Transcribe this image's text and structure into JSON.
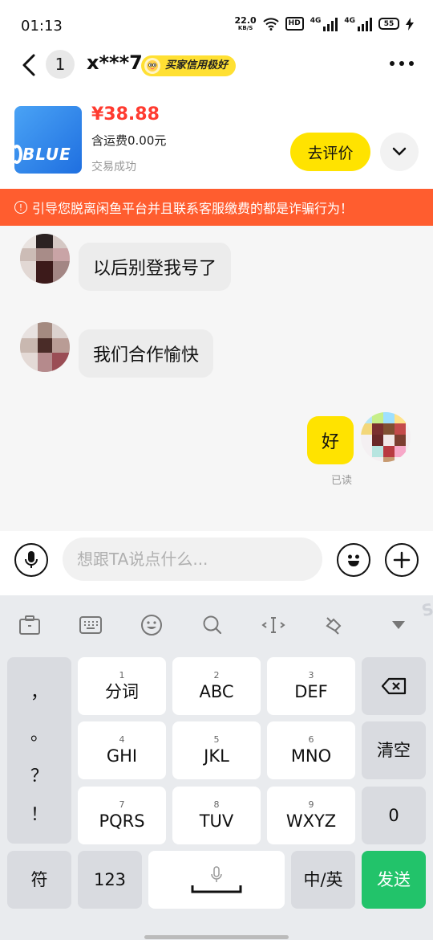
{
  "status": {
    "time": "01:13",
    "speed": "22.0",
    "speed_unit": "KB/S",
    "hd": "HD",
    "net1": "4G",
    "net2": "4G",
    "battery": "55"
  },
  "header": {
    "unread_count": "1",
    "username": "x***7",
    "credit_badge": "买家信用极好"
  },
  "product": {
    "price": "¥38.88",
    "shipping": "含运费0.00元",
    "status": "交易成功",
    "thumb_text": "BLUE",
    "review_button": "去评价"
  },
  "warning": {
    "text": "引导您脱离闲鱼平台并且联系客服缴费的都是诈骗行为！"
  },
  "messages": [
    {
      "side": "left",
      "text": "以后别登我号了"
    },
    {
      "side": "left",
      "text": "我们合作愉快"
    },
    {
      "side": "right",
      "text": "好",
      "receipt": "已读"
    }
  ],
  "input": {
    "placeholder": "想跟TA说点什么..."
  },
  "keyboard": {
    "punctuation": [
      "，",
      "。",
      "？",
      "！"
    ],
    "rows": [
      [
        {
          "num": "1",
          "label": "分词"
        },
        {
          "num": "2",
          "label": "ABC"
        },
        {
          "num": "3",
          "label": "DEF"
        }
      ],
      [
        {
          "num": "4",
          "label": "GHI"
        },
        {
          "num": "5",
          "label": "JKL"
        },
        {
          "num": "6",
          "label": "MNO"
        }
      ],
      [
        {
          "num": "7",
          "label": "PQRS"
        },
        {
          "num": "8",
          "label": "TUV"
        },
        {
          "num": "9",
          "label": "WXYZ"
        }
      ]
    ],
    "clear": "清空",
    "zero": "0",
    "symbols": "符",
    "numbers": "123",
    "lang": "中/英",
    "send": "发送"
  },
  "colors": {
    "accent_yellow": "#ffe300",
    "warning_orange": "#ff5d2f",
    "price_red": "#ff3b30",
    "send_green": "#22c36a"
  }
}
